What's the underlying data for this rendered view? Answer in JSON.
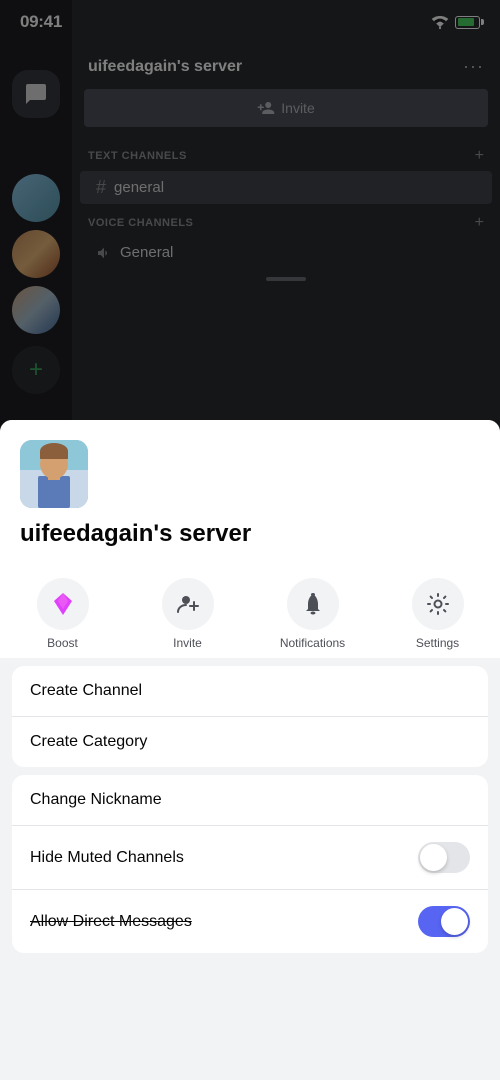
{
  "statusBar": {
    "time": "09:41"
  },
  "discordBg": {
    "serverName": "uifeedagain's server",
    "inviteLabel": "Invite",
    "textChannelsLabel": "TEXT CHANNELS",
    "voiceChannelsLabel": "VOICE CHANNELS",
    "generalText": "general",
    "generalVoice": "General"
  },
  "bottomSheet": {
    "serverName": "uifeedagain's server",
    "actions": {
      "boost": "Boost",
      "invite": "Invite",
      "notifications": "Notifications",
      "settings": "Settings"
    },
    "menuSection1": {
      "createChannel": "Create Channel",
      "createCategory": "Create Category"
    },
    "menuSection2": {
      "changeNickname": "Change Nickname",
      "hideMutedChannels": "Hide Muted Channels",
      "allowDirectMessages": "Allow Direct Messages"
    }
  }
}
